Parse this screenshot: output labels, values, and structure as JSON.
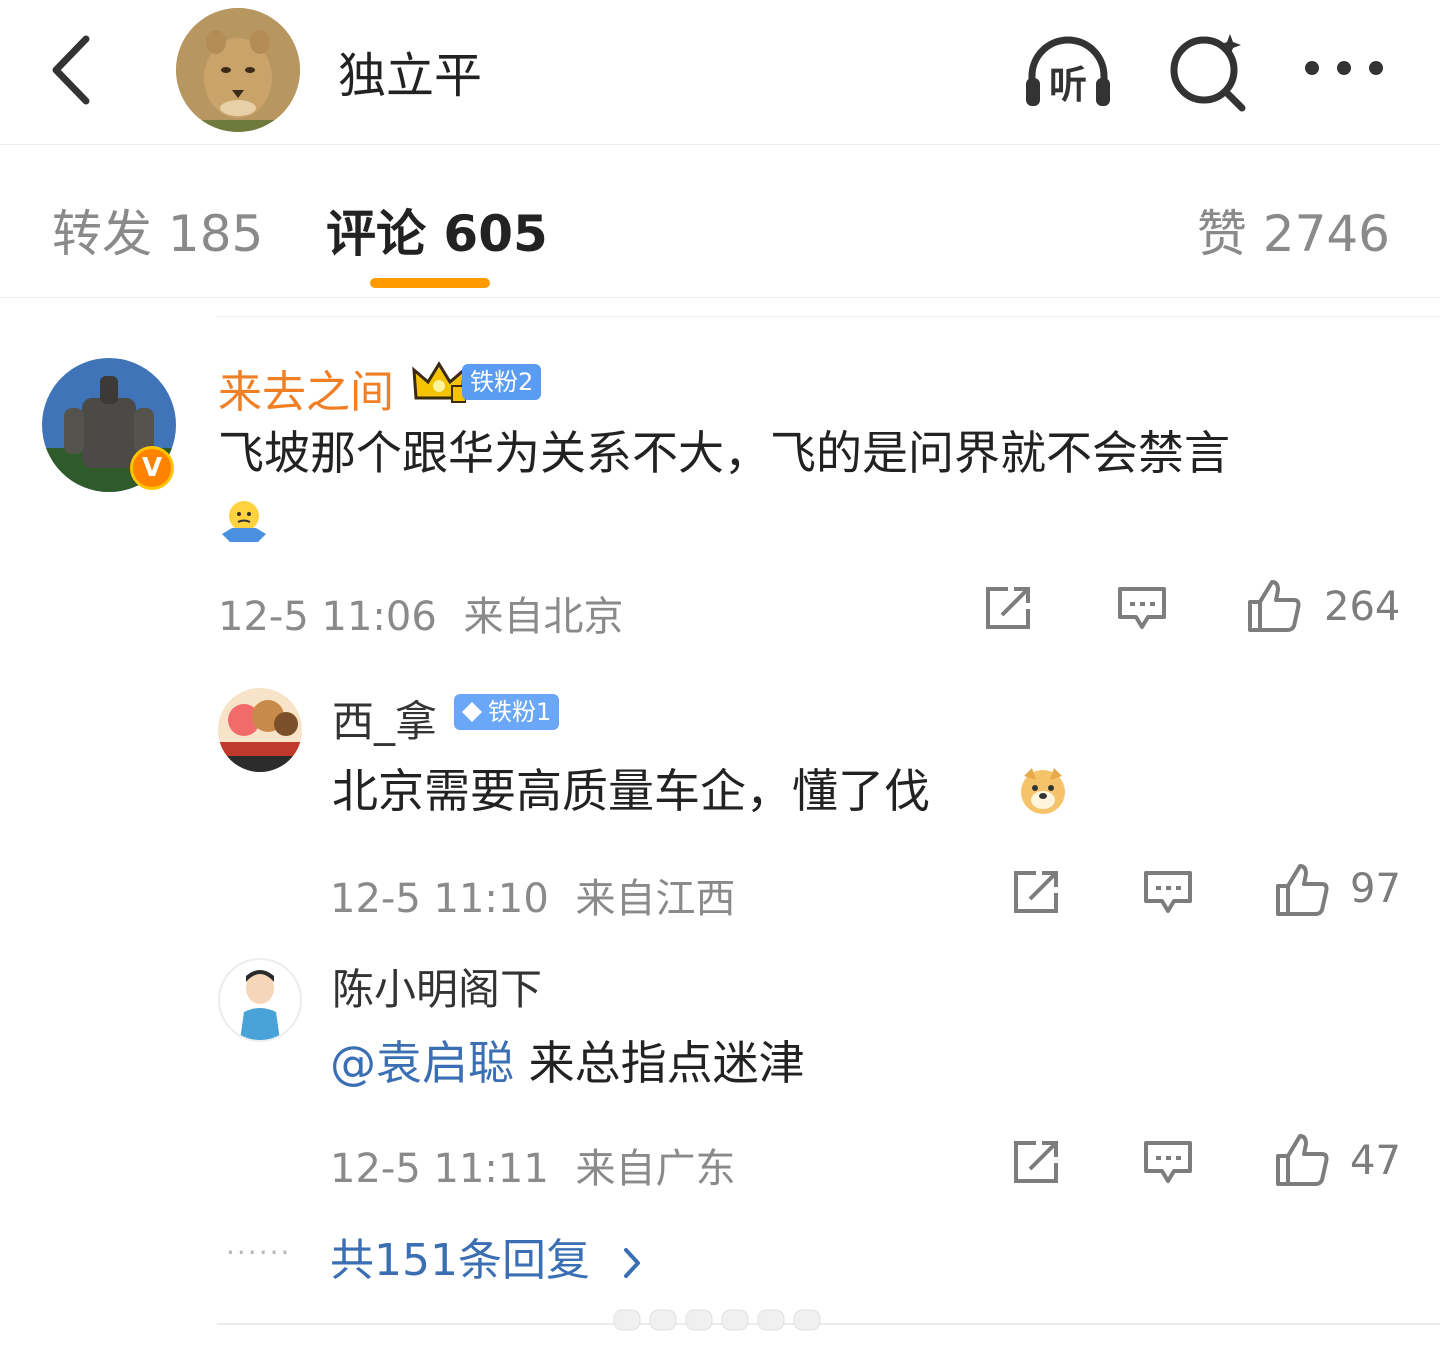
{
  "header": {
    "title": "独立平",
    "listen_label": "听"
  },
  "tabs": {
    "repost": "转发 185",
    "comments": "评论 605",
    "likes": "赞 2746"
  },
  "comment": {
    "username": "来去之间",
    "fan_badge": "铁粉2",
    "text": "飞坡那个跟华为关系不大，飞的是问界就不会禁言",
    "emoji": "shrug-emoji",
    "time": "12-5 11:06",
    "location": "来自北京",
    "likes": "264",
    "verified_mark": "V"
  },
  "replies": [
    {
      "username": "西_拿",
      "fan_badge": "铁粉1",
      "text": "北京需要高质量车企，懂了伐",
      "emoji": "doge-emoji",
      "time": "12-5 11:10",
      "location": "来自江西",
      "likes": "97"
    },
    {
      "username": "陈小明阁下",
      "mention": "@袁启聪",
      "text": " 来总指点迷津",
      "time": "12-5 11:11",
      "location": "来自广东",
      "likes": "47"
    }
  ],
  "replies_more": {
    "leader": "······",
    "label": "共151条回复"
  },
  "colors": {
    "accent": "#ff9a00",
    "username_highlight": "#f07f26",
    "link": "#3b6fb3",
    "badge": "#5a9cf2"
  }
}
